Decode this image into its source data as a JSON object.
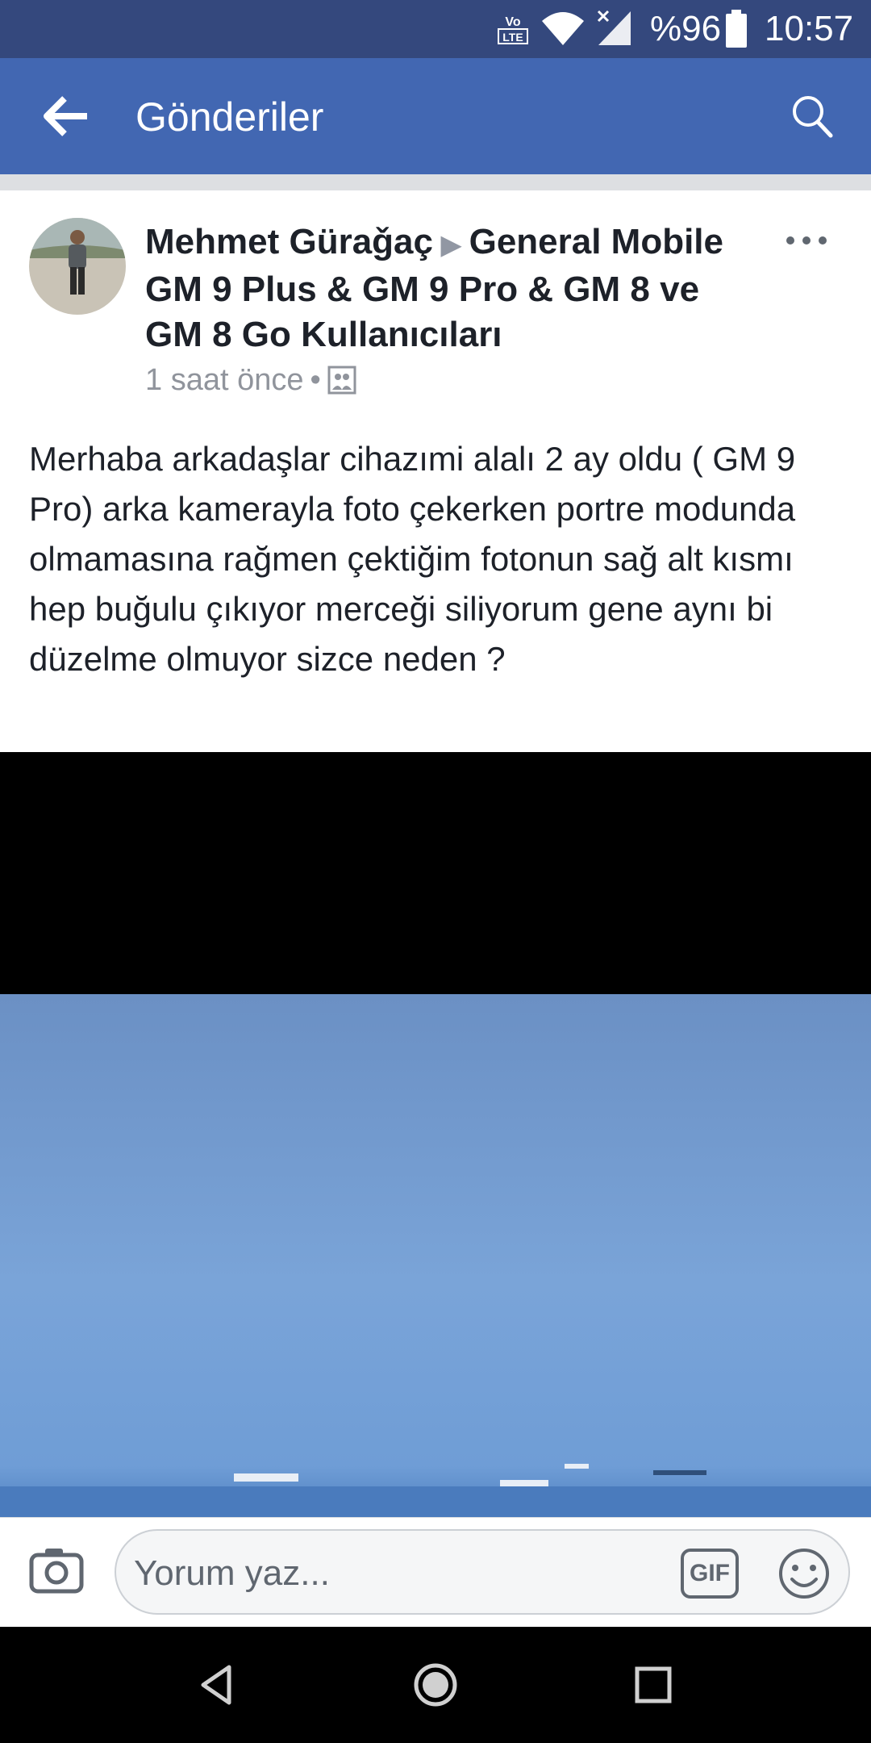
{
  "status_bar": {
    "network_badge": "Vo LTE",
    "battery": "%96",
    "time": "10:57"
  },
  "header": {
    "title": "Gönderiler"
  },
  "post": {
    "author": "Mehmet Güraǧaç",
    "group": "General Mobile GM 9 Plus & GM 9 Pro & GM 8 ve GM 8 Go Kullanıcıları",
    "timestamp": "1 saat önce",
    "separator": "•",
    "text": "Merhaba arkadaşlar cihazımi alalı 2 ay oldu ( GM 9 Pro) arka kamerayla foto çekerken portre modunda olmamasına rağmen çektiğim fotonun sağ alt kısmı hep buğulu çıkıyor merceği siliyorum gene aynı bi düzelme olmuyor sizce neden ?"
  },
  "comment_bar": {
    "placeholder": "Yorum yaz...",
    "gif_label": "GIF"
  },
  "colors": {
    "status_bar": "#34487d",
    "app_bar": "#4267b2",
    "author_text": "#1d2129",
    "meta_text": "#90949c"
  },
  "icons": [
    "back-arrow-icon",
    "search-icon",
    "more-icon",
    "photo-icon",
    "camera-icon",
    "gif-icon",
    "emoji-icon",
    "nav-back-icon",
    "nav-home-icon",
    "nav-recents-icon"
  ]
}
